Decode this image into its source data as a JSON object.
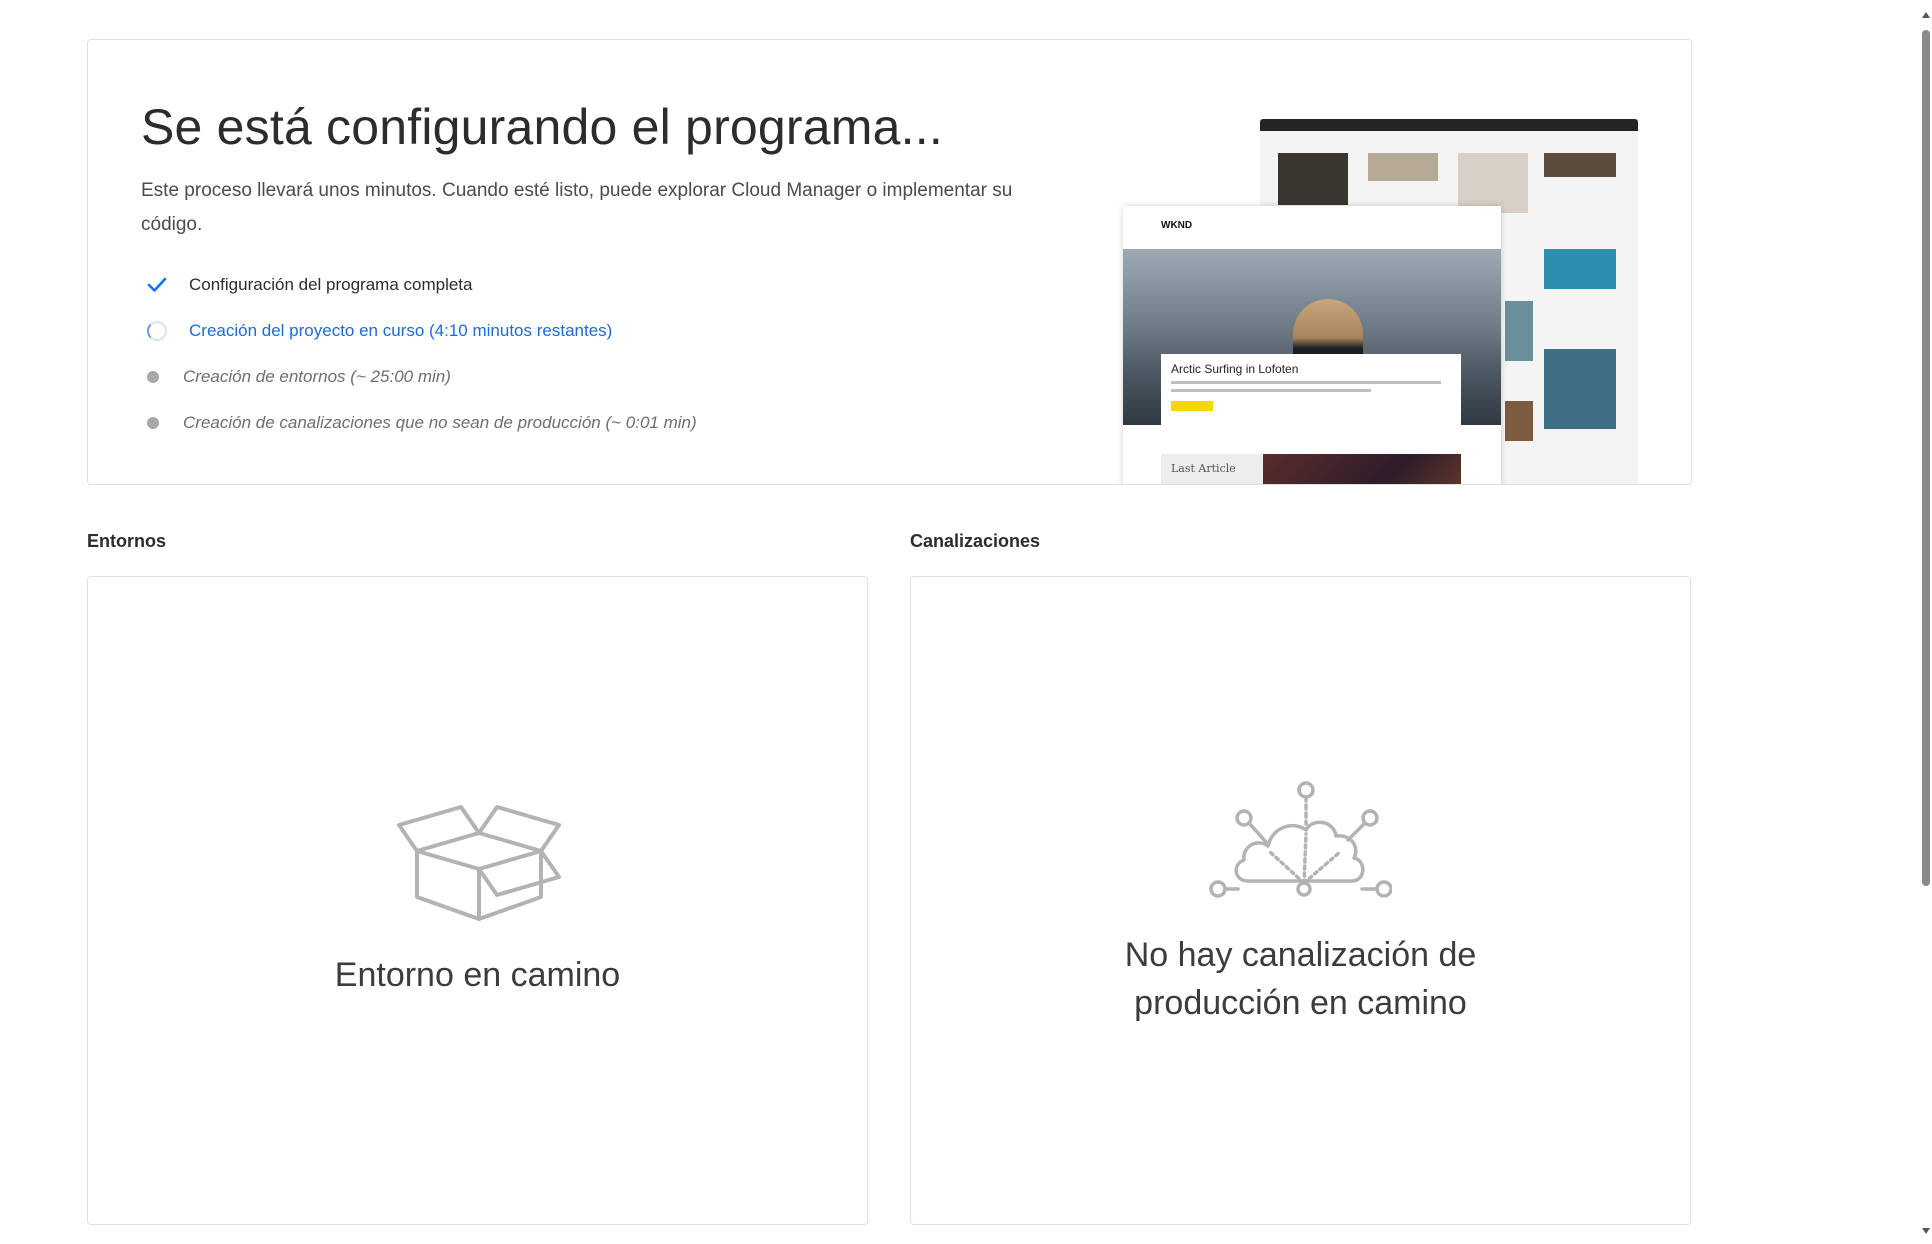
{
  "setup": {
    "title": "Se está configurando el programa...",
    "description": "Este proceso llevará unos minutos. Cuando esté listo, puede explorar Cloud Manager o implementar su código.",
    "steps": [
      {
        "label": "Configuración del programa completa",
        "status": "done",
        "icon": "checkmark-icon"
      },
      {
        "label": "Creación del proyecto en curso (4:10 minutos restantes)",
        "status": "active",
        "icon": "spinner-icon"
      },
      {
        "label": "Creación de entornos (~ 25:00 min)",
        "status": "pending",
        "icon": "dot-icon"
      },
      {
        "label": "Creación de canalizaciones que no sean de producción (~ 0:01 min)",
        "status": "pending",
        "icon": "dot-icon"
      }
    ],
    "preview": {
      "logo": "WKND",
      "article_title": "Arctic Surfing in Lofoten",
      "last_article": "Last Article"
    }
  },
  "environments": {
    "heading": "Entornos",
    "empty_message": "Entorno en camino",
    "icon": "box-icon"
  },
  "pipelines": {
    "heading": "Canalizaciones",
    "empty_message_line1": "No hay canalización de",
    "empty_message_line2": "producción en camino",
    "icon": "cloud-network-icon"
  },
  "colors": {
    "accent_blue": "#1c6bd6",
    "check_blue": "#1473e6",
    "border": "#e1e1e1",
    "muted_text": "#6e6e6e",
    "icon_gray": "#b3b3b3"
  }
}
